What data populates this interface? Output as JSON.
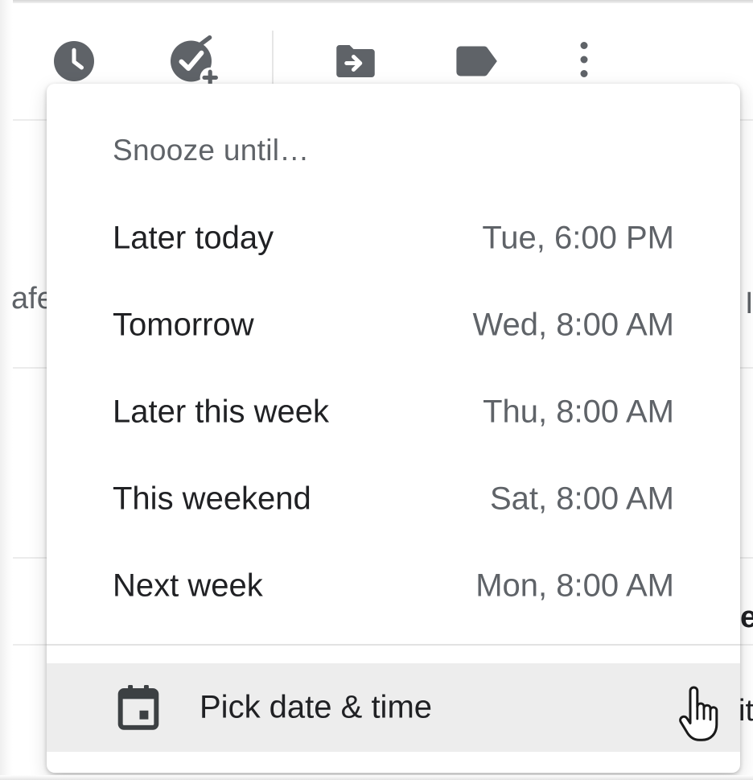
{
  "toolbar": {
    "icons": [
      "snooze-icon",
      "add-to-tasks-icon",
      "move-to-icon",
      "label-icon",
      "more-vert-icon"
    ]
  },
  "background": {
    "left_fragment": "afe",
    "right_fragment_1": "I",
    "right_fragment_2": "e",
    "right_fragment_3": "it"
  },
  "snooze_menu": {
    "header": "Snooze until…",
    "options": [
      {
        "label": "Later today",
        "time": "Tue, 6:00 PM"
      },
      {
        "label": "Tomorrow",
        "time": "Wed, 8:00 AM"
      },
      {
        "label": "Later this week",
        "time": "Thu, 8:00 AM"
      },
      {
        "label": "This weekend",
        "time": "Sat, 8:00 AM"
      },
      {
        "label": "Next week",
        "time": "Mon, 8:00 AM"
      }
    ],
    "pick_label": "Pick date & time",
    "pick_icon": "calendar-icon"
  },
  "colors": {
    "icon": "#5f6368",
    "text_primary": "#202124",
    "text_secondary": "#5f6368",
    "hover_bg": "#ededed"
  }
}
